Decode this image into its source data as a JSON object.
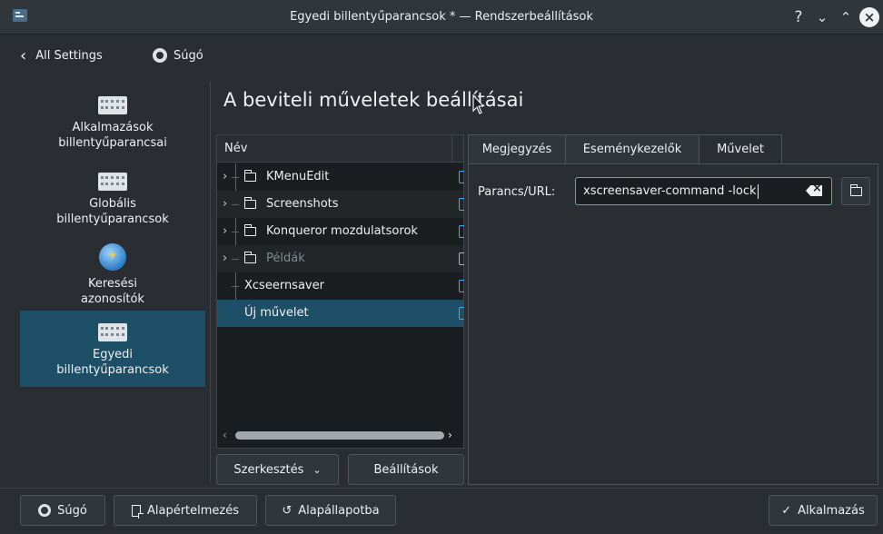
{
  "window": {
    "title": "Egyedi billentyűparancsok * — Rendszerbeállítások",
    "help_glyph": "?",
    "minimize_glyph": "⌄",
    "maximize_glyph": "⌃",
    "close_glyph": "×"
  },
  "header": {
    "back_label": "All Settings",
    "help_label": "Súgó"
  },
  "sidebar": {
    "items": [
      {
        "label": "Alkalmazások billentyűparancsai",
        "icon": "keyboard-icon"
      },
      {
        "label": "Globális billentyűparancsok",
        "icon": "keyboard-icon"
      },
      {
        "label": "Keresési azonosítók",
        "icon": "globe-icon"
      },
      {
        "label": "Egyedi billentyűparancsok",
        "icon": "keyboard-icon",
        "active": true
      }
    ]
  },
  "page": {
    "title": "A beviteli műveletek beállításai"
  },
  "tree": {
    "header": "Név",
    "rows": [
      {
        "label": "KMenuEdit",
        "folder": true
      },
      {
        "label": "Screenshots",
        "folder": true
      },
      {
        "label": "Konqueror mozdulatsorok",
        "folder": true
      },
      {
        "label": "Példák",
        "folder": true,
        "disabled": true
      },
      {
        "label": "Xcseernsaver",
        "folder": false
      },
      {
        "label": "Új művelet",
        "folder": false,
        "selected": true
      }
    ],
    "scroll_left": "‹",
    "scroll_right": "›"
  },
  "tree_buttons": {
    "edit_label": "Szerkesztés",
    "edit_caret": "⌄",
    "settings_label": "Beállítások"
  },
  "tabs": {
    "items": [
      "Megjegyzés",
      "Eseménykezelők",
      "Művelet"
    ],
    "active": "Művelet"
  },
  "action": {
    "command_label": "Parancs/URL:",
    "command_value": "xscreensaver-command  -lock"
  },
  "footer": {
    "help_label": "Súgó",
    "defaults_label": "Alapértelmezés",
    "reset_label": "Alapállapotba",
    "reset_glyph": "↺",
    "apply_label": "Alkalmazás",
    "apply_glyph": "✓"
  }
}
